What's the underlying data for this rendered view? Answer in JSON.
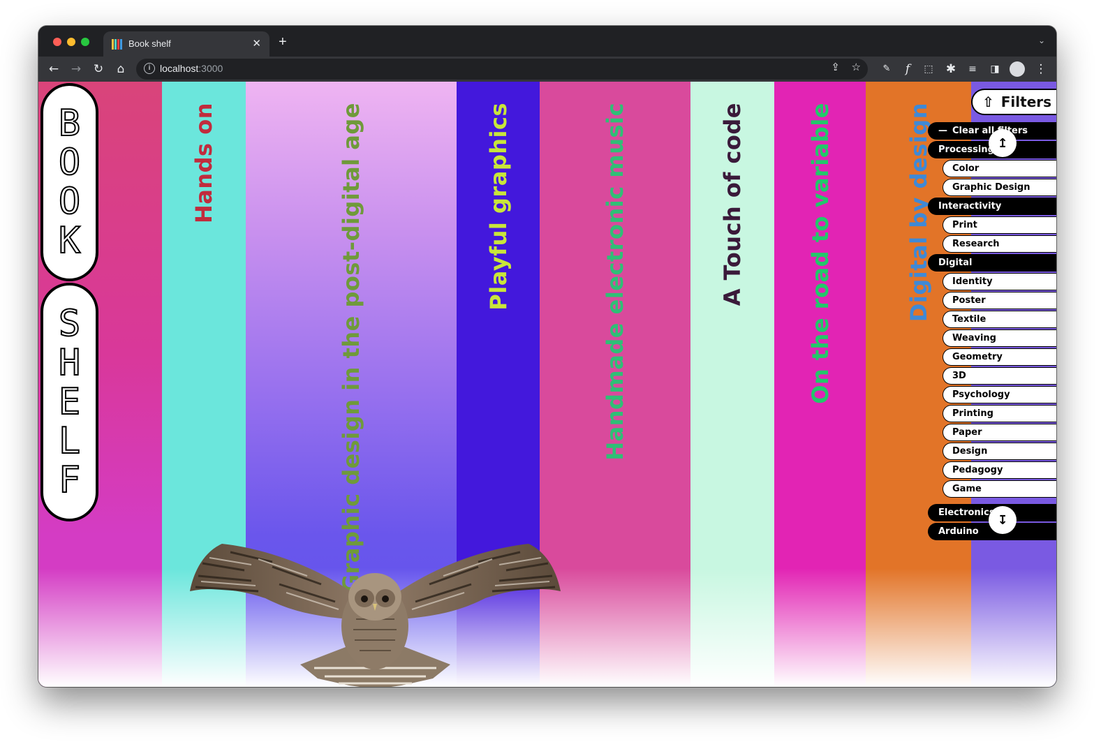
{
  "browser": {
    "tab_title": "Book shelf",
    "new_tab": "+",
    "close_tab": "✕",
    "url_host": "localhost",
    "url_port": ":3000"
  },
  "logo": {
    "word1": [
      "B",
      "O",
      "O",
      "K"
    ],
    "word2": [
      "S",
      "H",
      "E",
      "L",
      "F"
    ]
  },
  "books": [
    {
      "title": "",
      "bg": "#d9447a"
    },
    {
      "title": "Hands on",
      "bg": "#6be6dc",
      "color": "#c12b3d"
    },
    {
      "title": "Graphic design in the post-digital age",
      "bg": "#a468f0",
      "color": "#6f9a3a"
    },
    {
      "title": "Playful graphics",
      "bg": "#4318dc",
      "color": "#c9e63a"
    },
    {
      "title": "Handmade electronic music",
      "bg": "#d94a9c",
      "color": "#2fbf76"
    },
    {
      "title": "A Touch of code",
      "bg": "#c8f7e1",
      "color": "#3a1a3a"
    },
    {
      "title": "On the road to variable",
      "bg": "#e224b4",
      "color": "#22c86a"
    },
    {
      "title": "Digital by design",
      "bg": "#e27428",
      "color": "#3f89d6"
    },
    {
      "title": "",
      "bg": "#7a5ae2"
    }
  ],
  "filters": {
    "button_label": "Filters",
    "clear_label": "Clear all filters",
    "rows": [
      {
        "type": "cat",
        "label": "Processing"
      },
      {
        "type": "tag",
        "label": "Color"
      },
      {
        "type": "tag",
        "label": "Graphic Design"
      },
      {
        "type": "cat",
        "label": "Interactivity"
      },
      {
        "type": "tag",
        "label": "Print"
      },
      {
        "type": "tag",
        "label": "Research"
      },
      {
        "type": "cat",
        "label": "Digital"
      },
      {
        "type": "tag",
        "label": "Identity"
      },
      {
        "type": "tag",
        "label": "Poster"
      },
      {
        "type": "tag",
        "label": "Textile"
      },
      {
        "type": "tag",
        "label": "Weaving"
      },
      {
        "type": "tag",
        "label": "Geometry"
      },
      {
        "type": "tag",
        "label": "3D"
      },
      {
        "type": "tag",
        "label": "Psychology"
      },
      {
        "type": "tag",
        "label": "Printing"
      },
      {
        "type": "tag",
        "label": "Paper"
      },
      {
        "type": "tag",
        "label": "Design"
      },
      {
        "type": "tag",
        "label": "Pedagogy"
      },
      {
        "type": "tag",
        "label": "Game"
      }
    ],
    "bottom_rows": [
      {
        "type": "cat",
        "label": "Electronics"
      },
      {
        "type": "cat",
        "label": "Arduino"
      }
    ],
    "scroll_up_icon": "↥",
    "scroll_down_icon": "↧"
  }
}
